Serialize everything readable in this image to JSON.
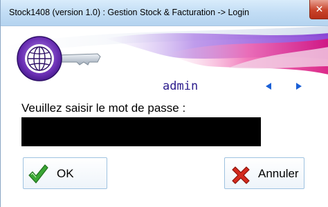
{
  "window": {
    "title": "Stock1408 (version 1.0) : Gestion Stock & Facturation -> Login",
    "close_glyph": "✕"
  },
  "login": {
    "username": "admin",
    "prompt": "Veuillez saisir le mot de passe :",
    "password_value": ""
  },
  "buttons": {
    "ok_label": "OK",
    "cancel_label": "Annuler"
  },
  "icons": {
    "logo": "globe-key-icon",
    "prev": "arrow-left-icon",
    "next": "arrow-right-icon",
    "ok": "green-check-icon",
    "cancel": "red-x-icon"
  },
  "colors": {
    "nav_arrow": "#1a5fd6",
    "username": "#2a1a8c",
    "banner_purple": "#8a2bd8",
    "banner_pink": "#e0208a",
    "check_green": "#3aa634",
    "cancel_red": "#d42a1e"
  }
}
